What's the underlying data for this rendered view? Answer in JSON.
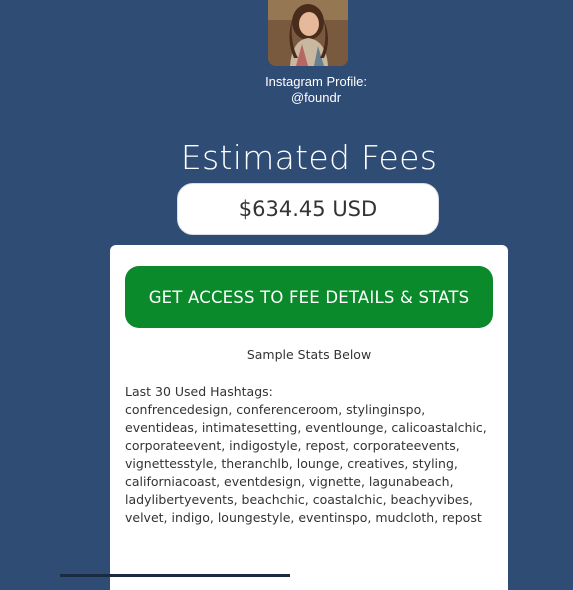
{
  "profile": {
    "avatar_alt": "profile photo",
    "caption_line1": "Instagram Profile:",
    "caption_line2": "@foundr"
  },
  "fees": {
    "title": "Estimated Fees",
    "amount": "$634.45 USD"
  },
  "card": {
    "cta_label": "GET ACCESS TO FEE DETAILS & STATS",
    "sample_label": "Sample Stats Below",
    "hashtags_heading": "Last 30 Used Hashtags:",
    "hashtag_lines": [
      "confrencedesign, conferenceroom, stylinginspo,",
      "eventideas, intimatesetting, eventlounge, calicoastalchic,",
      "corporateevent, indigostyle, repost, corporateevents,",
      "vignettesstyle, theranchlb, lounge, creatives, styling,",
      "californiacoast, eventdesign, vignette, lagunabeach,",
      "ladylibertyevents, beachchic, coastalchic, beachyvibes,",
      "velvet, indigo, loungestyle, eventinspo, mudcloth, repost"
    ]
  },
  "colors": {
    "background": "#2f4c75",
    "cta_green": "#0a8a2b",
    "card_white": "#ffffff",
    "text_dark": "#333333"
  }
}
